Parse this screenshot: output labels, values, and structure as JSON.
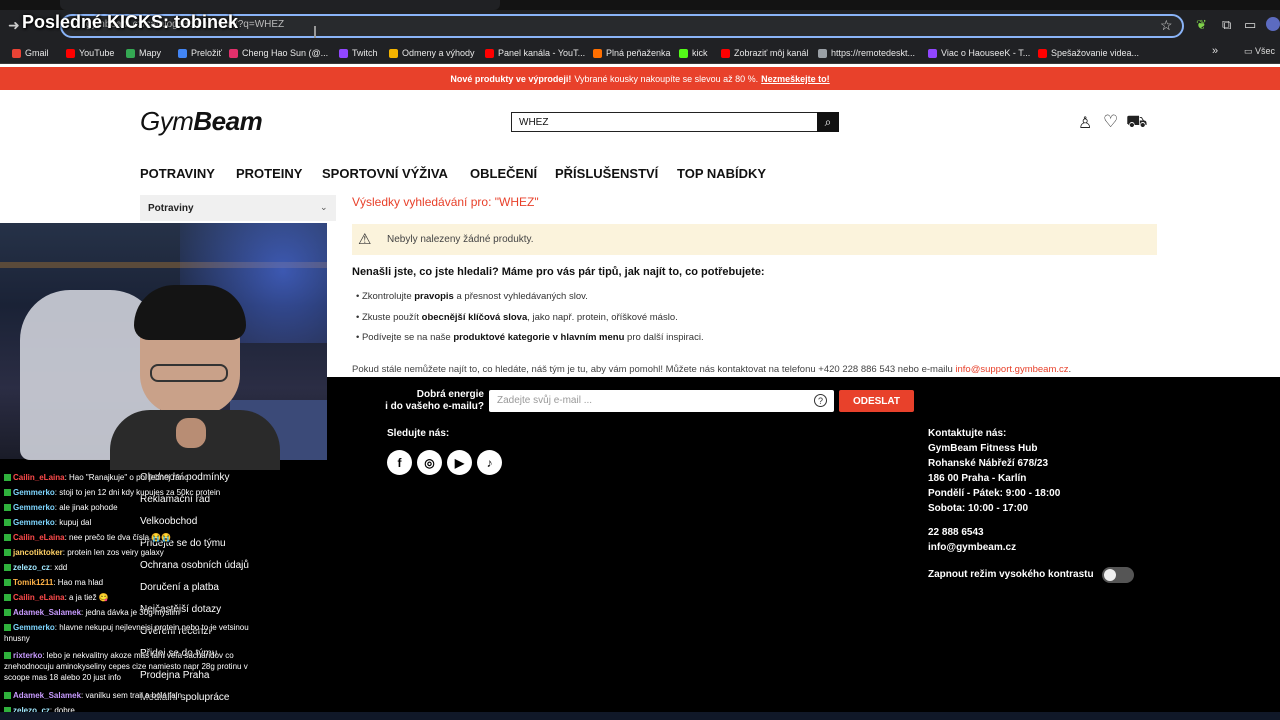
{
  "stream": {
    "title": "Posledné KICKS: tobinek"
  },
  "browser": {
    "url": "gymbeam.cz/catalogsearch/result/?q=WHEZ",
    "bookmarks": [
      {
        "label": "Gmail",
        "color": "#ea4335"
      },
      {
        "label": "YouTube",
        "color": "#ff0000"
      },
      {
        "label": "Mapy",
        "color": "#34a853"
      },
      {
        "label": "Preložiť",
        "color": "#4285f4"
      },
      {
        "label": "Cheng Hao Sun (@...",
        "color": "#e1306c"
      },
      {
        "label": "Twitch",
        "color": "#9146ff"
      },
      {
        "label": "Odmeny a výhody",
        "color": "#f4b400"
      },
      {
        "label": "Panel kanála - YouT...",
        "color": "#ff0000"
      },
      {
        "label": "Plná peňaženka",
        "color": "#ff6f00"
      },
      {
        "label": "kick",
        "color": "#53fc18"
      },
      {
        "label": "Zobraziť môj kanál",
        "color": "#ff0000"
      },
      {
        "label": "https://remotedeskt...",
        "color": "#9aa0a6"
      },
      {
        "label": "Viac o HaouseeK - T...",
        "color": "#9146ff"
      },
      {
        "label": "Spešažovanie videa...",
        "color": "#ff0000"
      }
    ],
    "bookmarks_overflow": "Všec",
    "icons": {
      "back": "back-arrow-icon",
      "star": "star-icon",
      "extension": "puzzle-icon"
    }
  },
  "promo": {
    "lead": "Nové produkty ve výprodeji!",
    "text": "Vybrané kousky nakoupíte se slevou až 80 %.",
    "cta": "Nezmeškejte to!"
  },
  "header": {
    "logo_light": "Gym",
    "logo_bold": "Beam",
    "search_value": "WHEZ"
  },
  "nav": [
    "POTRAVINY",
    "PROTEINY",
    "SPORTOVNÍ VÝŽIVA",
    "OBLEČENÍ",
    "PŘÍSLUŠENSTVÍ",
    "TOP NABÍDKY"
  ],
  "sidebar": {
    "filter_label": "Potraviny"
  },
  "results": {
    "title": "Výsledky vyhledávání pro: \"WHEZ\"",
    "notice": "Nebyly nalezeny žádné produkty.",
    "tips_heading": "Nenašli jste, co jste hledali? Máme pro vás pár tipů, jak najít to, co potřebujete:",
    "tips": [
      {
        "pre": "Zkontrolujte ",
        "bold": "pravopis",
        "post": " a přesnost vyhledávaných slov."
      },
      {
        "pre": "Zkuste použít ",
        "bold": "obecnější klíčová slova",
        "post": ", jako např. protein, oříškové máslo."
      },
      {
        "pre": "Podívejte se na naše ",
        "bold": "produktové kategorie v hlavním menu",
        "post": " pro další inspiraci."
      }
    ],
    "contact_text": "Pokud stále nemůžete najít to, co hledáte, náš tým je tu, aby vám pomohl! Můžete nás kontaktovat na telefonu +420 228 886 543 nebo e-mailu ",
    "contact_email": "info@support.gymbeam.cz",
    "contact_end": "."
  },
  "footer": {
    "newsletter_label_1": "Dobrá energie",
    "newsletter_label_2": "i do vašeho e-mailu?",
    "newsletter_placeholder": "Zadejte svůj e-mail ...",
    "newsletter_button": "ODESLAT",
    "follow_label": "Sledujte nás:",
    "social": [
      {
        "name": "facebook-icon",
        "glyph": "f"
      },
      {
        "name": "instagram-icon",
        "glyph": "◎"
      },
      {
        "name": "youtube-icon",
        "glyph": "▶"
      },
      {
        "name": "tiktok-icon",
        "glyph": "♪"
      }
    ],
    "contact_heading": "Kontaktujte nás:",
    "contact_lines": [
      "GymBeam Fitness Hub",
      "Rohanské Nábřeží 678/23",
      "186 00 Praha - Karlín",
      "Pondělí - Pátek: 9:00 - 18:00",
      "Sobota: 10:00 - 17:00"
    ],
    "phone": "22 888 6543",
    "email": "info@gymbeam.cz",
    "contrast_label": "Zapnout režim vysokého kontrastu",
    "links": [
      "Obchodní podmínky",
      "Reklamační řád",
      "Velkoobchod",
      "Přidejte se do týmu",
      "Ochrana osobních údajů",
      "Doručení a platba",
      "Nejčastější dotazy",
      "Ověření recenzí",
      "Přidej se do týmu",
      "Prodejna Praha",
      "Mediální spolupráce"
    ]
  },
  "chat": [
    {
      "user": "Cailin_eLaina",
      "color": "#ff4b4b",
      "msg": ": Hao \"Ranajkuje\" o pol jednej ráno"
    },
    {
      "user": "Gemmerko",
      "color": "#7ed6ff",
      "msg": ": stoji to jen 12 dni kdy kupujes za 50kc protein"
    },
    {
      "user": "Gemmerko",
      "color": "#7ed6ff",
      "msg": ": ale jinak pohode"
    },
    {
      "user": "Gemmerko",
      "color": "#7ed6ff",
      "msg": ": kupuj dal"
    },
    {
      "user": "Cailin_eLaina",
      "color": "#ff4b4b",
      "msg": ": nee prečo tie dva čísla 😭😭"
    },
    {
      "user": "jancotiktoker",
      "color": "#ffd166",
      "msg": ": protein len zos veiry galaxy"
    },
    {
      "user": "zelezo_cz",
      "color": "#a0e8ff",
      "msg": ": xdd"
    },
    {
      "user": "Tomik1211",
      "color": "#ffb347",
      "msg": ": Hao ma hlad"
    },
    {
      "user": "Cailin_eLaina",
      "color": "#ff4b4b",
      "msg": ": a ja tiež 😋"
    },
    {
      "user": "Adamek_Salamek",
      "color": "#c89bff",
      "msg": ": jedna dávka je 30g myslim"
    },
    {
      "user": "Gemmerko",
      "color": "#7ed6ff",
      "msg": ": hlavne nekupuj nejlevnejsi protein nebo to je vetsinou hnusny"
    },
    {
      "user": "rixterko",
      "color": "#c89bff",
      "msg": ": lebo je nekvalitny akoze mas tam veľa sacharidov co znehodnocuju aminokyseliny cepes cize namiesto napr 28g protinu v scoope mas 18 alebo 20 just info"
    },
    {
      "user": "Adamek_Salamek",
      "color": "#c89bff",
      "msg": ": vanilku sem trail a bola fajn"
    },
    {
      "user": "zelezo_cz",
      "color": "#a0e8ff",
      "msg": ": dobre"
    }
  ]
}
